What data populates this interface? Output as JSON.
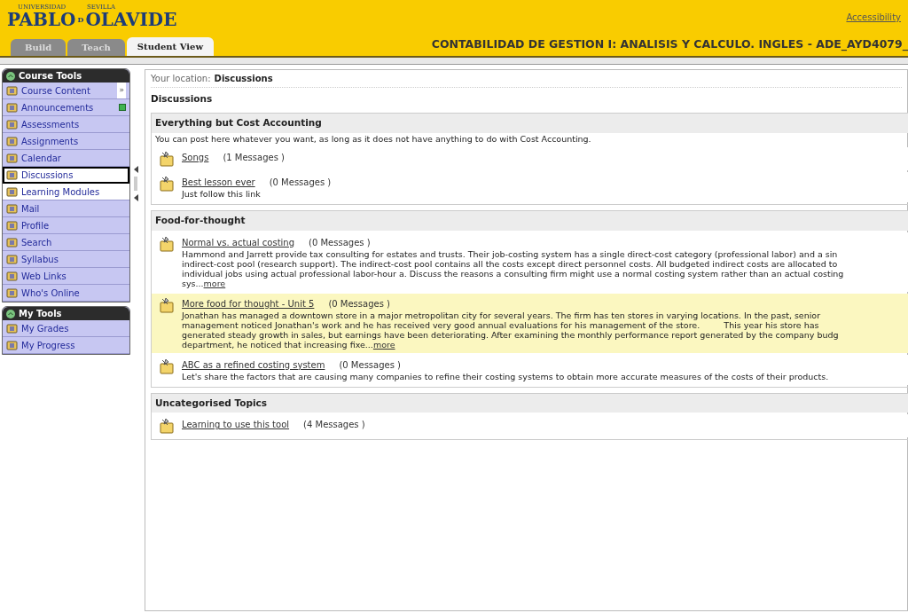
{
  "header": {
    "logo": {
      "top_left": "UNIVERSIDAD",
      "top_right": "SEVILLA",
      "word_1": "PABLO",
      "joiner": "D",
      "word_2": "OLAVIDE"
    },
    "accessibility_link": "Accessibility",
    "course_title": "CONTABILIDAD DE GESTION I: ANALISIS Y CALCULO. INGLES - ADE_AYD4079_",
    "tabs": [
      {
        "label": "Build",
        "selected": false
      },
      {
        "label": "Teach",
        "selected": false
      },
      {
        "label": "Student View",
        "selected": true
      }
    ]
  },
  "sidebar": {
    "sections": [
      {
        "title": "Course Tools",
        "items": [
          {
            "label": "Course Content",
            "selected": false,
            "hovered": false,
            "badge": "»"
          },
          {
            "label": "Announcements",
            "selected": false,
            "hovered": false,
            "new": true
          },
          {
            "label": "Assessments",
            "selected": false,
            "hovered": false
          },
          {
            "label": "Assignments",
            "selected": false,
            "hovered": false
          },
          {
            "label": "Calendar",
            "selected": false,
            "hovered": false
          },
          {
            "label": "Discussions",
            "selected": true,
            "hovered": false
          },
          {
            "label": "Learning Modules",
            "selected": false,
            "hovered": true
          },
          {
            "label": "Mail",
            "selected": false,
            "hovered": false
          },
          {
            "label": "Profile",
            "selected": false,
            "hovered": false
          },
          {
            "label": "Search",
            "selected": false,
            "hovered": false
          },
          {
            "label": "Syllabus",
            "selected": false,
            "hovered": false
          },
          {
            "label": "Web Links",
            "selected": false,
            "hovered": false
          },
          {
            "label": "Who's Online",
            "selected": false,
            "hovered": false
          }
        ]
      },
      {
        "title": "My Tools",
        "items": [
          {
            "label": "My Grades",
            "selected": false,
            "hovered": false
          },
          {
            "label": "My Progress",
            "selected": false,
            "hovered": false
          }
        ]
      }
    ]
  },
  "breadcrumb": {
    "label": "Your location:",
    "current": "Discussions"
  },
  "page_title": "Discussions",
  "categories": [
    {
      "title": "Everything but Cost Accounting",
      "description": "You can post here whatever you want, as long as it does not have anything to do with Cost Accounting.",
      "topics": [
        {
          "title": "Songs",
          "count": "(1 Messages )",
          "highlighted": false
        },
        {
          "title": "Best lesson ever",
          "count": "(0 Messages )",
          "highlighted": false,
          "lines": [
            "Just follow this link"
          ]
        }
      ]
    },
    {
      "title": "Food-for-thought",
      "topics": [
        {
          "title": "Normal vs. actual costing",
          "count": "(0 Messages )",
          "highlighted": false,
          "lines": [
            "Hammond and Jarrett provide tax consulting for estates and trusts. Their job-costing system has a single direct-cost category (professional labor) and a sin",
            "indirect-cost pool (research support). The indirect-cost pool contains all the costs except direct personnel costs. All budgeted indirect costs are allocated to",
            "individual jobs using actual professional labor-hour a. Discuss the reasons a consulting firm might use a normal costing system rather than an actual costing",
            "sys..."
          ],
          "more": "more"
        },
        {
          "title": "More food for thought - Unit 5",
          "count": "(0 Messages )",
          "highlighted": true,
          "lines": [
            "Jonathan has managed a downtown store in a major metropolitan city for several years. The firm has ten stores in varying locations. In the past, senior",
            "management noticed Jonathan's work and he has received very good annual evaluations for his management of the store.         This year his store has",
            "generated steady growth in sales, but earnings have been deteriorating. After examining the monthly performance report generated by the company budg",
            "department, he noticed that increasing fixe..."
          ],
          "more": "more"
        },
        {
          "title": "ABC as a refined costing system",
          "count": "(0 Messages )",
          "highlighted": false,
          "lines": [
            "Let's share the factors that are causing many companies to refine their costing systems to obtain more accurate measures of the costs of their products."
          ]
        }
      ]
    },
    {
      "title": "Uncategorised Topics",
      "topics": [
        {
          "title": "Learning to use this tool",
          "count": "(4 Messages )",
          "highlighted": false
        }
      ]
    }
  ]
}
